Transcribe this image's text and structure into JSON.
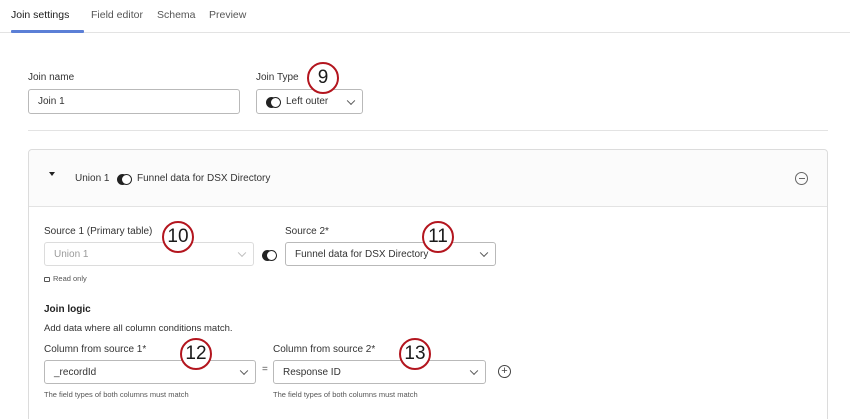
{
  "tabs": [
    {
      "label": "Join settings",
      "active": true
    },
    {
      "label": "Field editor",
      "active": false
    },
    {
      "label": "Schema",
      "active": false
    },
    {
      "label": "Preview",
      "active": false
    }
  ],
  "join_name": {
    "label": "Join name",
    "value": "Join 1"
  },
  "join_type": {
    "label": "Join Type",
    "value": "Left outer",
    "icon": "left-outer-join-icon"
  },
  "panel": {
    "title_left": "Union 1",
    "title_right": "Funnel data for DSX Directory",
    "source1": {
      "label": "Source 1 (Primary table)",
      "value": "Union 1",
      "read_only_label": "Read only"
    },
    "source2": {
      "label": "Source 2*",
      "value": "Funnel data for DSX Directory"
    },
    "join_logic": {
      "heading": "Join logic",
      "description": "Add data where all column conditions match.",
      "col1": {
        "label": "Column from source 1*",
        "value": "_recordId",
        "hint": "The field types of both columns must match"
      },
      "col2": {
        "label": "Column from source 2*",
        "value": "Response ID",
        "hint": "The field types of both columns must match"
      },
      "equals": "="
    }
  },
  "badges": [
    "9",
    "10",
    "11",
    "12",
    "13"
  ],
  "colors": {
    "accent": "#5b7fd6",
    "badge_border": "#b3151e"
  }
}
